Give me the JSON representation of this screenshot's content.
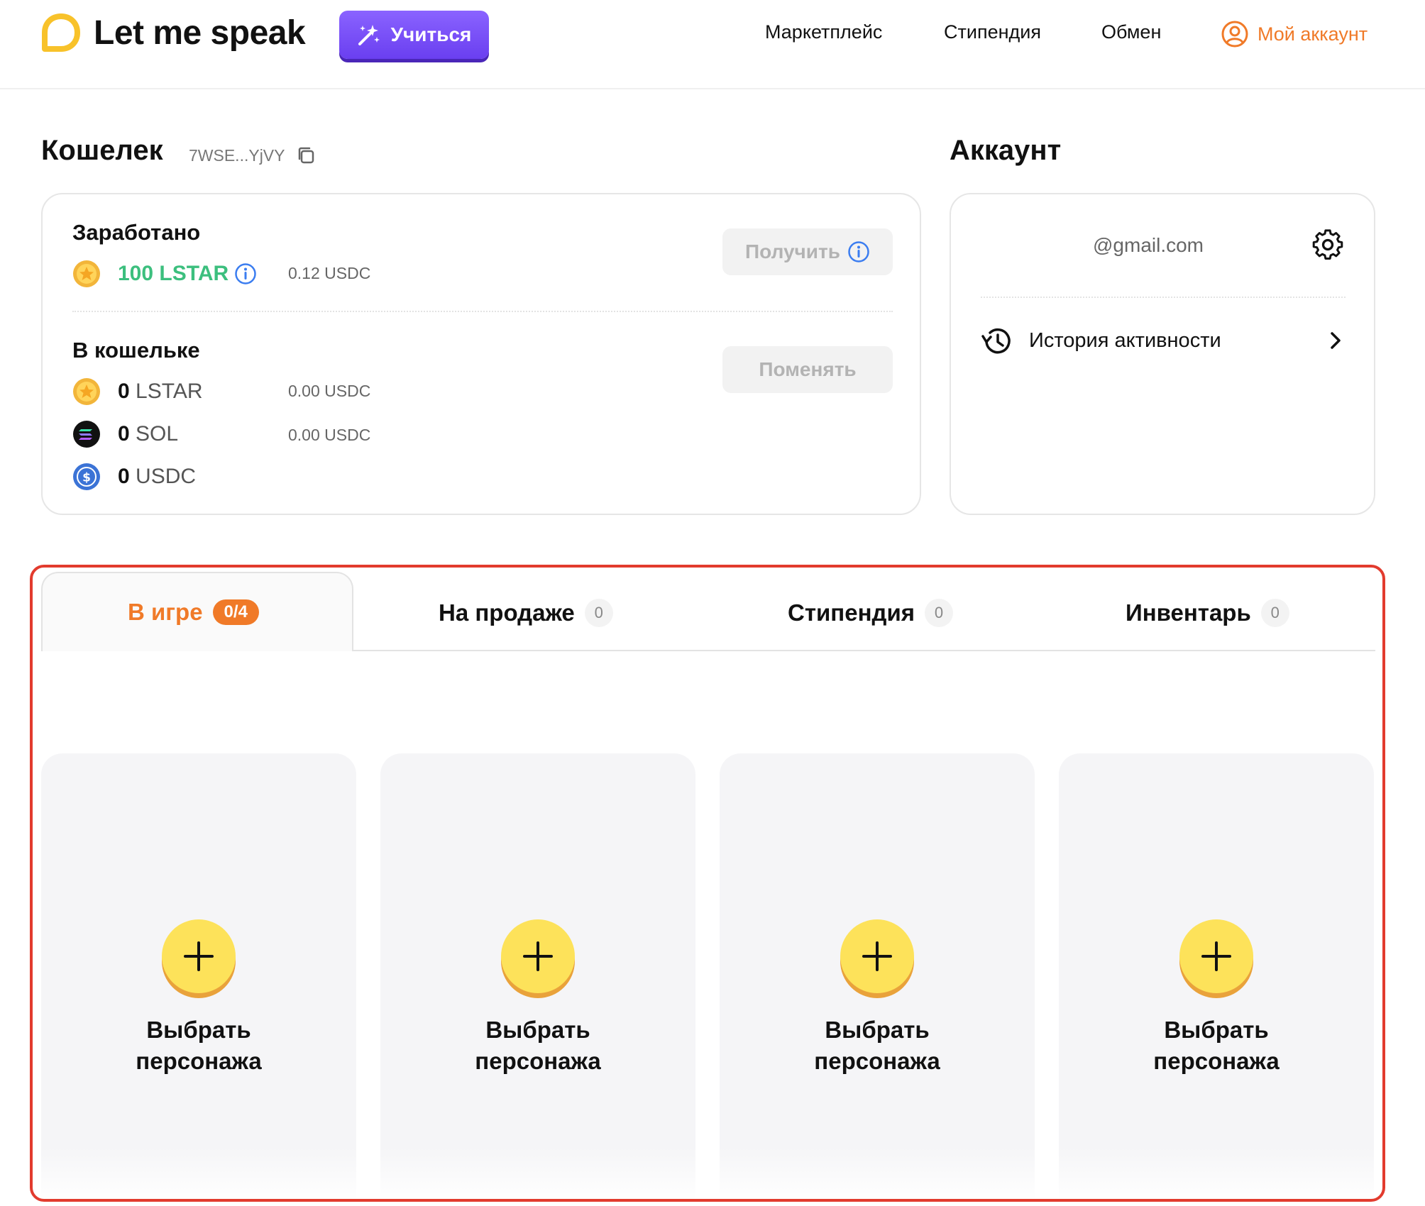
{
  "header": {
    "brand": "Let me speak",
    "learn_button": "Учиться",
    "nav": [
      "Маркетплейс",
      "Стипендия",
      "Обмен"
    ],
    "account": "Мой аккаунт",
    "accent_color": "#f07a28",
    "learn_color": "#7a4ff8"
  },
  "wallet": {
    "title": "Кошелек",
    "address": "7WSE...YjVY",
    "earned": {
      "label": "Заработано",
      "amount": "100 LSTAR",
      "usdc": "0.12 USDC",
      "claim_button": "Получить"
    },
    "in_wallet": {
      "label": "В кошельке",
      "swap_button": "Поменять",
      "items": [
        {
          "amount": "0",
          "unit": "LSTAR",
          "usdc": "0.00 USDC",
          "icon": "lstar-coin-icon"
        },
        {
          "amount": "0",
          "unit": "SOL",
          "usdc": "0.00 USDC",
          "icon": "sol-coin-icon"
        },
        {
          "amount": "0",
          "unit": "USDC",
          "usdc": "",
          "icon": "usdc-coin-icon"
        }
      ]
    }
  },
  "account": {
    "title": "Аккаунт",
    "email": "@gmail.com",
    "history": "История активности"
  },
  "tabs": [
    {
      "label": "В игре",
      "count": "0/4",
      "active": true
    },
    {
      "label": "На продаже",
      "count": "0",
      "active": false
    },
    {
      "label": "Стипендия",
      "count": "0",
      "active": false
    },
    {
      "label": "Инвентарь",
      "count": "0",
      "active": false
    }
  ],
  "slots": [
    {
      "label": "Выбрать\nперсонажа"
    },
    {
      "label": "Выбрать\nперсонажа"
    },
    {
      "label": "Выбрать\nперсонажа"
    },
    {
      "label": "Выбрать\nперсонажа"
    }
  ]
}
